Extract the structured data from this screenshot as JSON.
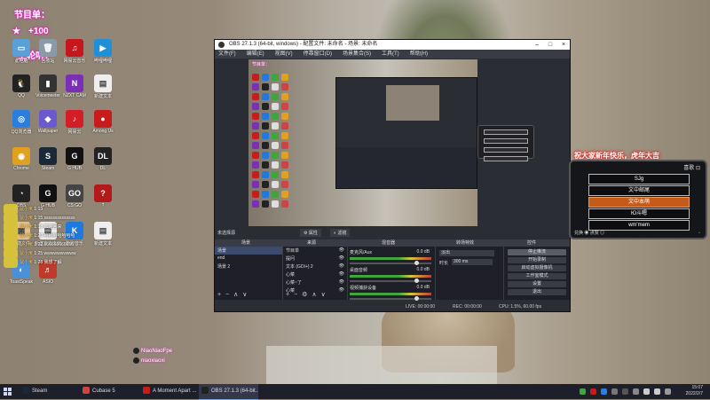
{
  "overlay": {
    "line1": "节目单：",
    "line2": "+100",
    "line3": "上轮听：",
    "line4": "★"
  },
  "desktop_icons": [
    {
      "label": "此电脑",
      "color": "#5aa0d8",
      "glyph": "▭",
      "icon": "computer-icon"
    },
    {
      "label": "回收站",
      "color": "#8a9aa8",
      "glyph": "🗑",
      "icon": "recycle-bin-icon"
    },
    {
      "label": "网易云音乐",
      "color": "#c8161d",
      "glyph": "♫",
      "icon": "netease-music-icon"
    },
    {
      "label": "哔哩哔哩",
      "color": "#1f8fd8",
      "glyph": "▶",
      "icon": "app-icon"
    },
    {
      "label": "QQ",
      "color": "#222",
      "glyph": "🐧",
      "icon": "qq-icon"
    },
    {
      "label": "Voicemeeter",
      "color": "#333",
      "glyph": "▮",
      "icon": "audio-meter-icon"
    },
    {
      "label": "NZXT CAM",
      "color": "#7a2fb5",
      "glyph": "N",
      "icon": "nzxt-icon"
    },
    {
      "label": "新建文本",
      "color": "#eee",
      "glyph": "▤",
      "icon": "document-icon"
    },
    {
      "label": "QQ浏览器",
      "color": "#2b7de0",
      "glyph": "◎",
      "icon": "browser-icon"
    },
    {
      "label": "Wallpaper",
      "color": "#6a5acd",
      "glyph": "◆",
      "icon": "wallpaper-icon"
    },
    {
      "label": "网易云",
      "color": "#d51d27",
      "glyph": "♪",
      "icon": "music-icon"
    },
    {
      "label": "Among Us",
      "color": "#c81c1c",
      "glyph": "●",
      "icon": "game-icon"
    },
    {
      "label": "Chrome",
      "color": "#e0a020",
      "glyph": "◉",
      "icon": "chrome-icon"
    },
    {
      "label": "Steam",
      "color": "#1b2838",
      "glyph": "S",
      "icon": "steam-icon"
    },
    {
      "label": "G HUB",
      "color": "#111",
      "glyph": "G",
      "icon": "logitech-icon"
    },
    {
      "label": "DL",
      "color": "#222",
      "glyph": "DL",
      "icon": "app-icon"
    },
    {
      "label": "OBS",
      "color": "#222",
      "glyph": "◔",
      "icon": "obs-icon"
    },
    {
      "label": "G HUB",
      "color": "#111",
      "glyph": "G",
      "icon": "logitech-icon"
    },
    {
      "label": "CS:GO",
      "color": "#444",
      "glyph": "GO",
      "icon": "csgo-icon"
    },
    {
      "label": "?",
      "color": "#b31b1b",
      "glyph": "?",
      "icon": "app-icon"
    },
    {
      "label": "新建文件",
      "color": "#e8c28a",
      "glyph": "▦",
      "icon": "archive-icon"
    },
    {
      "label": "新建文本文档",
      "color": "#eee",
      "glyph": "▤",
      "icon": "document-icon"
    },
    {
      "label": "酷狗音乐",
      "color": "#1f7ae0",
      "glyph": "K",
      "icon": "kugou-icon"
    },
    {
      "label": "新建文本",
      "color": "#eee",
      "glyph": "▤",
      "icon": "document-icon"
    },
    {
      "label": "ToastSpeak",
      "color": "#4a90d9",
      "glyph": "◐",
      "icon": "app-icon"
    },
    {
      "label": "ASIO",
      "color": "#c0392b",
      "glyph": "♬",
      "icon": "app-icon"
    }
  ],
  "chat": [
    {
      "user": "鼠小米",
      "text": "1:13"
    },
    {
      "user": "鼠小米",
      "text": "1:15 ssssssssssssss"
    },
    {
      "user": "鼠小米",
      "text": "1:18 欢迎回来"
    },
    {
      "user": "鼠小米",
      "text": "1:20 哈哈哈哈哈哈哈"
    },
    {
      "user": "鼠小米",
      "text": "1:22 666666666666"
    },
    {
      "user": "鼠小米",
      "text": "1:25 wwwwwwwwww"
    },
    {
      "user": "鼠小米",
      "text": "1:28 我想了解"
    }
  ],
  "obs": {
    "title": "OBS 27.1.3 (64-bit, windows) - 配置文件: 未命名 - 场景: 未命名",
    "menu": [
      "文件(F)",
      "编辑(E)",
      "视图(V)",
      "停靠窗口(D)",
      "场景集合(S)",
      "工具(T)",
      "帮助(H)"
    ],
    "preview_label": "未选择源",
    "prop_button": "属性",
    "filter_button": "滤镜",
    "docks": {
      "scenes": "场景",
      "sources": "来源",
      "mixer": "混音器",
      "transitions": "转场特效",
      "controls": "控件"
    },
    "scenes": [
      "场景",
      "end",
      "场景 2"
    ],
    "sources": [
      "节目单",
      "提问",
      "文本 (GDI+) 2",
      "心菜",
      "心菜~了",
      "心菜"
    ],
    "mixer": [
      {
        "name": "麦克风/Aux",
        "db": "0.0 dB"
      },
      {
        "name": "桌面音频",
        "db": "0.0 dB"
      },
      {
        "name": "视频捕获设备",
        "db": "0.0 dB"
      }
    ],
    "transition": {
      "type": "淡出",
      "duration_label": "时长",
      "duration": "300 ms"
    },
    "controls": [
      "停止推流",
      "开始录制",
      "启动虚拟摄像机",
      "工作室模式",
      "设置",
      "退出"
    ],
    "status": {
      "live": "LIVE: 00:00:00",
      "rec": "REC: 00:00:00",
      "cpu": "CPU: 1.5%, 60.00 fps"
    }
  },
  "stream_menu": {
    "greeting": "祝大家新年快乐，虎年大吉",
    "header": "喜歌 ⊡",
    "items": [
      "SJg",
      "文中邮尾",
      "文中本萌",
      "Ю斗嗯",
      "wm'mem"
    ],
    "selected_index": 2,
    "footer_left": "兑换 ◉ 点赞 ◎",
    "footer_right": "▫"
  },
  "social": [
    {
      "handle": "NiaoNiaoFpe"
    },
    {
      "handle": "niaoxiaoxi"
    }
  ],
  "taskbar": {
    "items": [
      {
        "label": "Steam",
        "color": "#1b2838",
        "icon": "steam-icon"
      },
      {
        "label": "Cubase 5",
        "color": "#c44",
        "icon": "cubase-icon"
      },
      {
        "label": "A Moment Apart ...",
        "color": "#c81c1c",
        "icon": "music-icon"
      },
      {
        "label": "OBS 27.1.3 (64-bit...",
        "color": "#222",
        "icon": "obs-icon"
      }
    ],
    "time": "15:07",
    "date": "2022/2/7"
  }
}
